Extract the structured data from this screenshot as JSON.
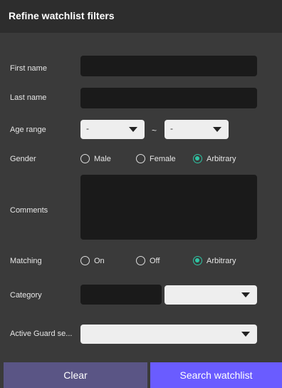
{
  "title": "Refine watchlist filters",
  "fields": {
    "first_name": "First name",
    "last_name": "Last name",
    "age_range": "Age range",
    "age_from": "-",
    "age_to": "-",
    "tilde": "~",
    "gender": "Gender",
    "comments": "Comments",
    "matching": "Matching",
    "category": "Category",
    "active_guard": "Active Guard se..."
  },
  "gender_options": [
    "Male",
    "Female",
    "Arbitrary"
  ],
  "gender_selected": "Arbitrary",
  "matching_options": [
    "On",
    "Off",
    "Arbitrary"
  ],
  "matching_selected": "Arbitrary",
  "buttons": {
    "clear": "Clear",
    "search": "Search watchlist"
  },
  "colors": {
    "accent": "#2ec4a3",
    "search_button": "#6a5cff",
    "clear_button": "#5a5585"
  }
}
